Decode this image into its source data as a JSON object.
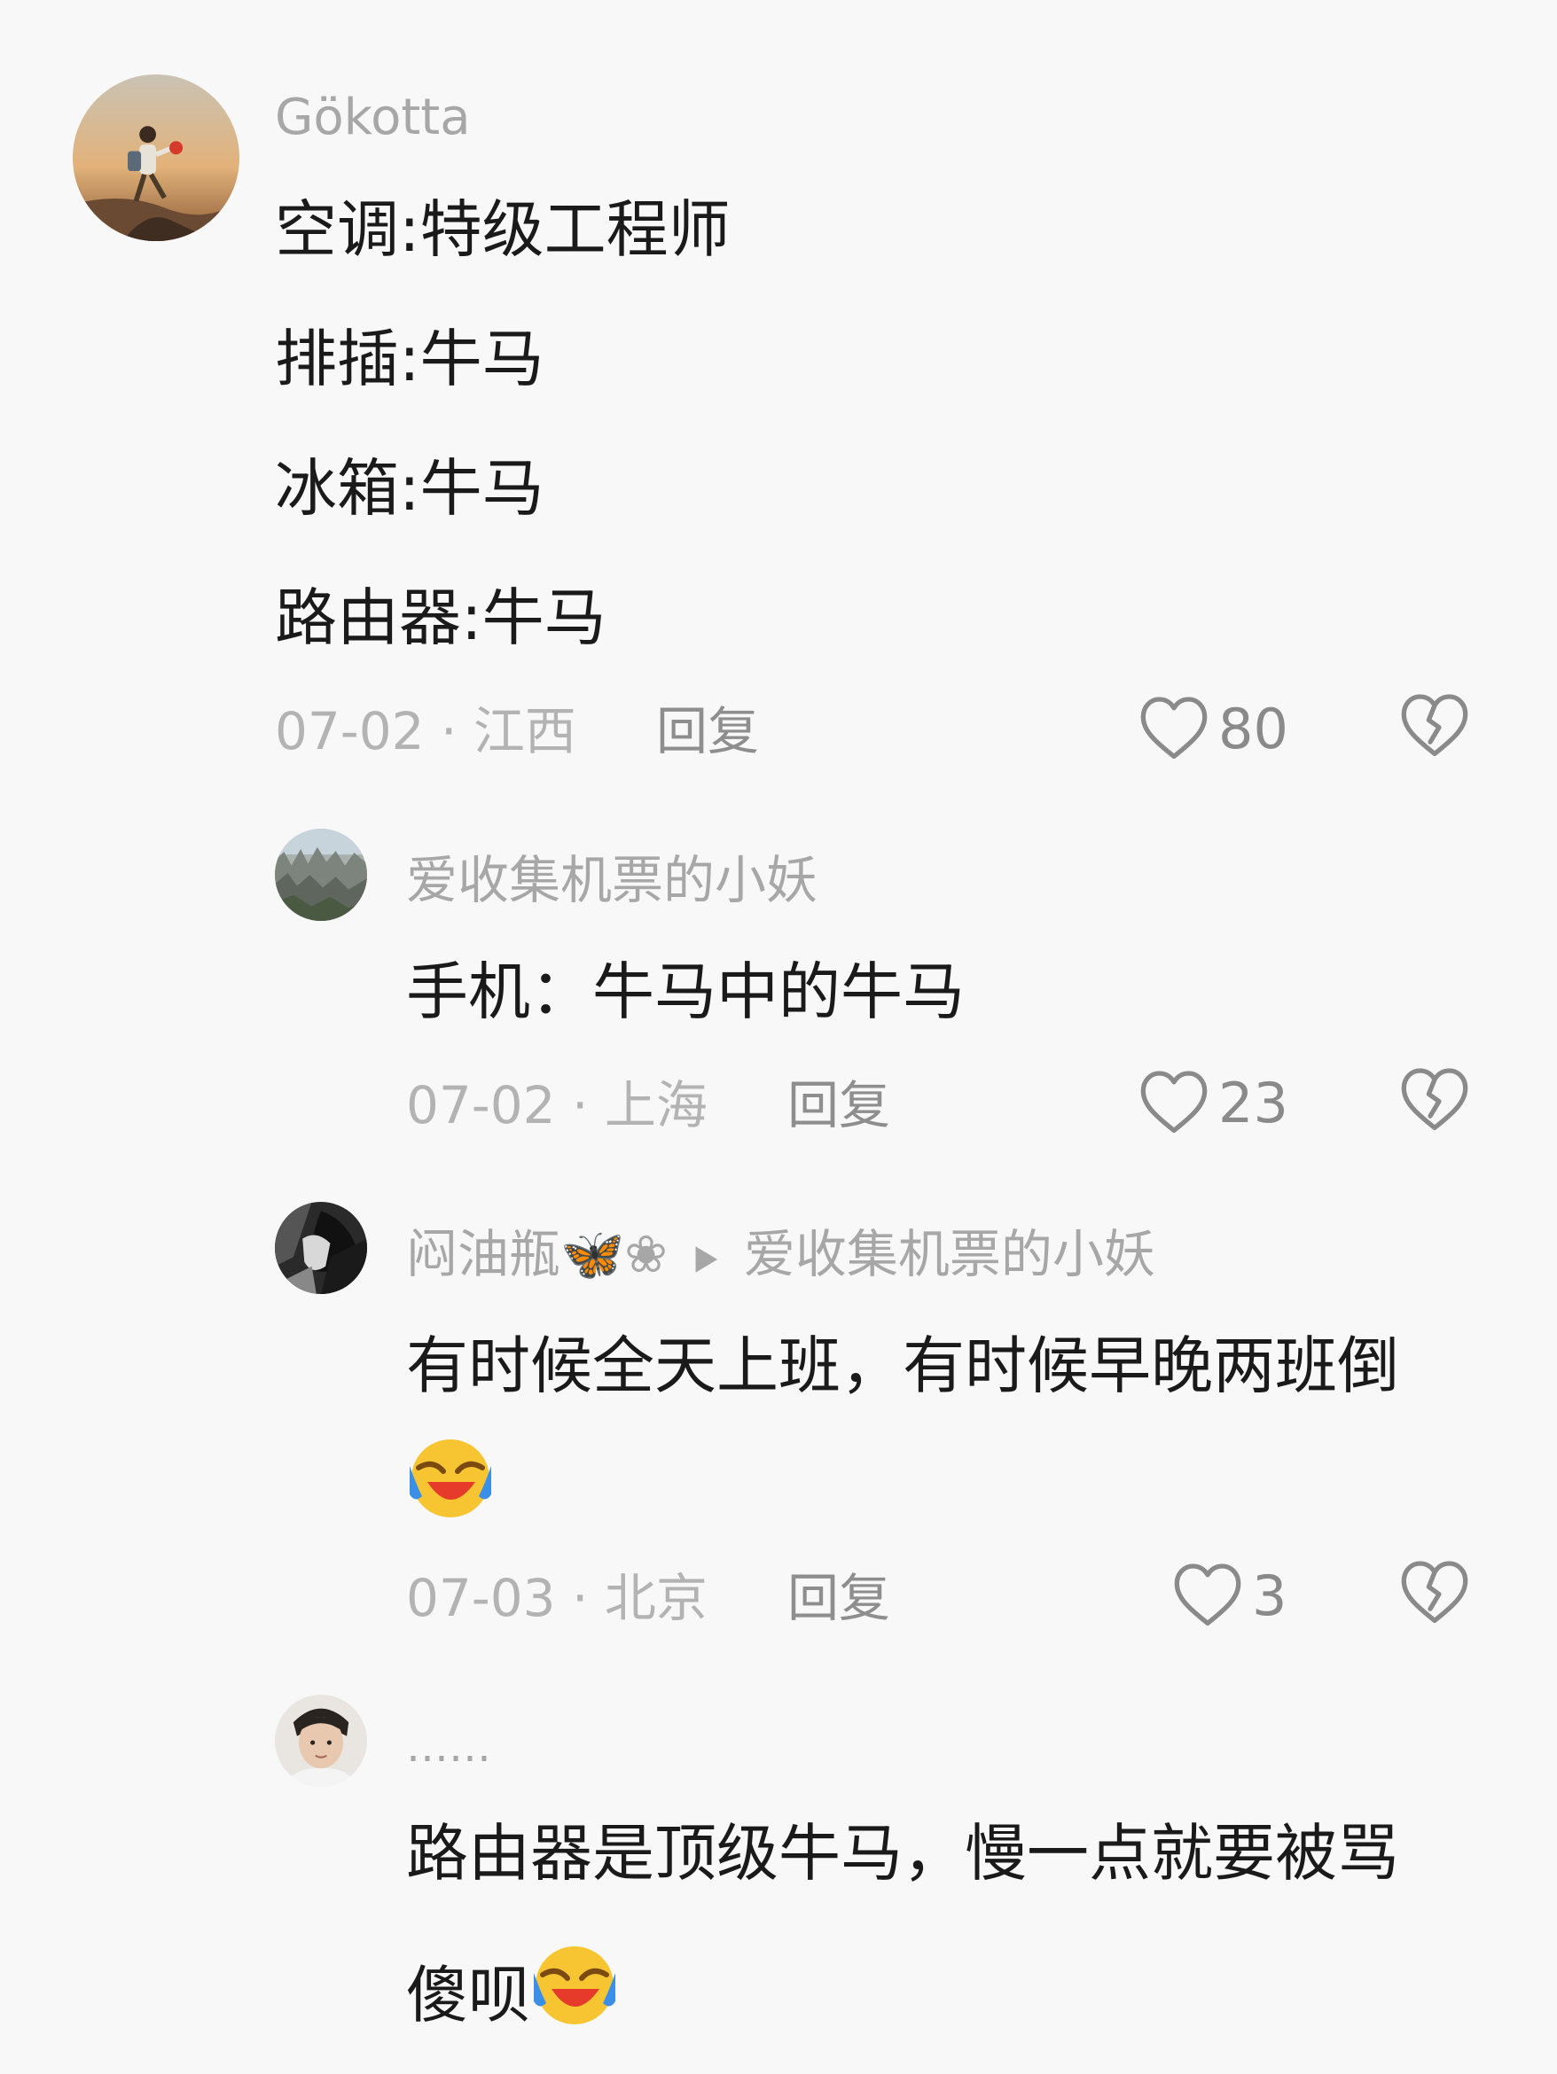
{
  "comments": [
    {
      "username": "Gökotta",
      "lines": [
        "空调:特级工程师",
        "排插:牛马",
        "冰箱:牛马",
        "路由器:牛马"
      ],
      "date": "07-02",
      "location": "江西",
      "reply_label": "回复",
      "likes": "80"
    },
    {
      "username": "爱收集机票的小妖",
      "lines": [
        "手机：牛马中的牛马"
      ],
      "date": "07-02",
      "location": "上海",
      "reply_label": "回复",
      "likes": "23"
    },
    {
      "username": "闷油瓶🦋❀",
      "reply_to": "爱收集机票的小妖",
      "lines": [
        "有时候全天上班，有时候早晚两班倒"
      ],
      "date": "07-03",
      "location": "北京",
      "reply_label": "回复",
      "likes": "3"
    },
    {
      "username": "……",
      "lines": [
        "路由器是顶级牛马，慢一点就要被骂",
        "傻呗"
      ]
    }
  ],
  "meta_separator": " · ",
  "icons": {
    "like": "heart-outline-icon",
    "dislike": "broken-heart-icon",
    "emoji": "crying-laughing-emoji",
    "reply_to": "play-triangle-icon"
  }
}
